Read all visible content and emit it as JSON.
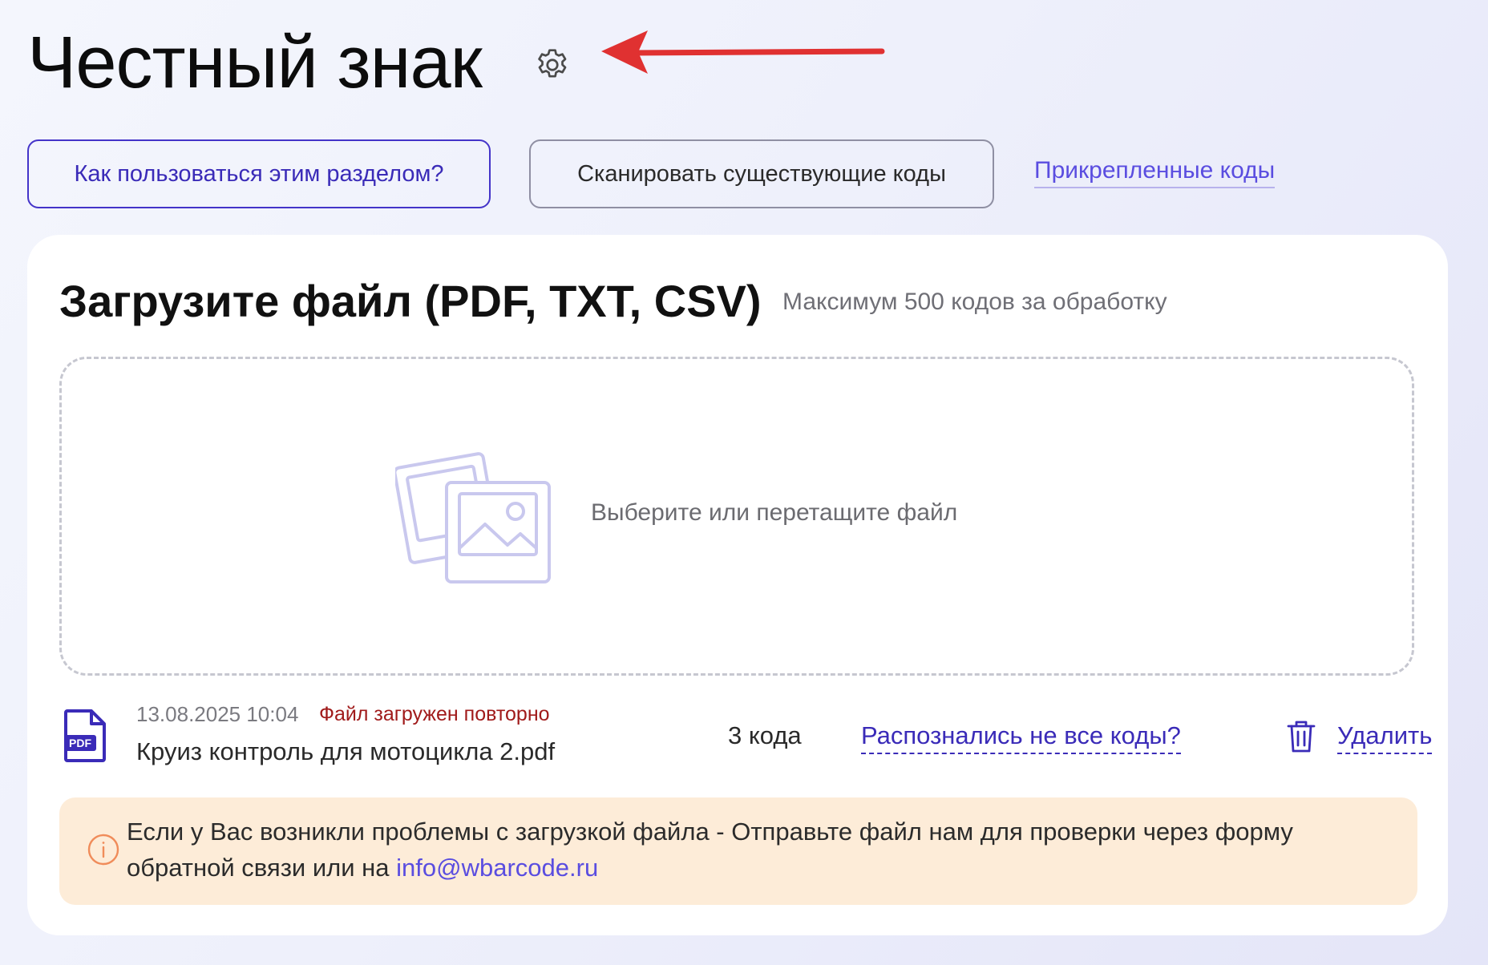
{
  "header": {
    "title": "Честный знак",
    "settings_icon": "gear-icon",
    "annotation_color": "#e03131"
  },
  "actions": {
    "help_button": "Как пользоваться этим разделом?",
    "scan_button": "Сканировать существующие коды",
    "attached_link": "Прикрепленные коды"
  },
  "upload": {
    "title": "Загрузите файл (PDF, TXT, CSV)",
    "limit_hint": "Максимум 500 кодов за обработку",
    "dropzone_text": "Выберите или перетащите файл",
    "dropzone_icon": "image-placeholder-icon"
  },
  "file": {
    "icon": "pdf-file-icon",
    "icon_label": "PDF",
    "date": "13.08.2025 10:04",
    "status": "Файл загружен повторно",
    "name": "Круиз контроль для мотоцикла 2.pdf",
    "code_count": "3 кода",
    "recognition_link": "Распознались не все коды?",
    "delete_label": "Удалить"
  },
  "notice": {
    "icon": "info-icon",
    "text": "Если у Вас возникли проблемы с загрузкой файла - Отправьте файл нам для проверки через форму обратной связи или на ",
    "email": "info@wbarcode.ru"
  },
  "colors": {
    "accent": "#3a2bb8",
    "link": "#5a4de0",
    "status_error": "#a01a1a",
    "notice_bg": "#fdecd8",
    "notice_icon": "#f08c5a"
  }
}
